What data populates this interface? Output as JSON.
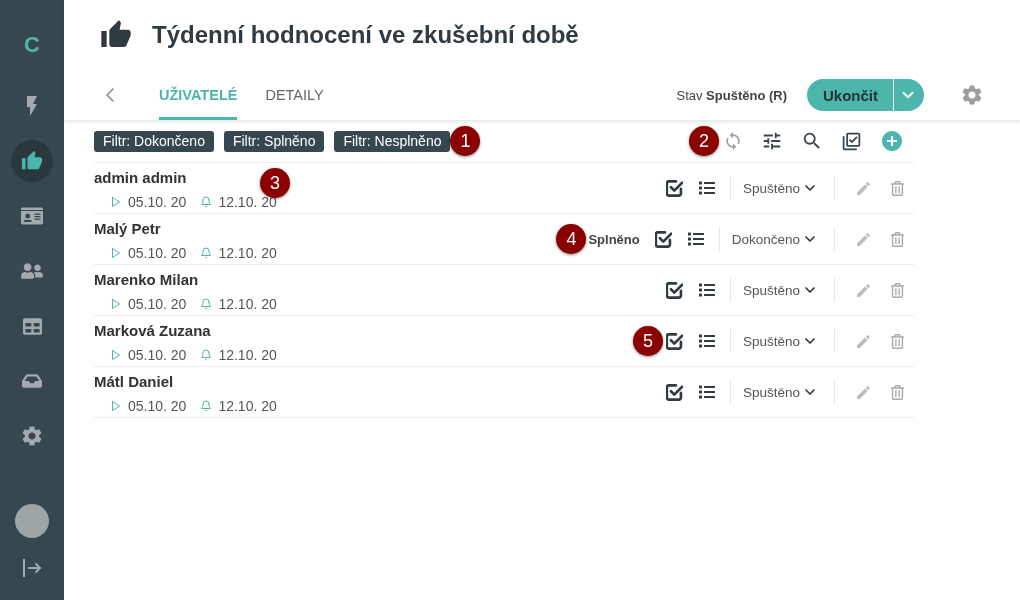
{
  "sidebar": {
    "logo": "C",
    "items": [
      {
        "selected": false
      },
      {
        "selected": true
      },
      {
        "selected": false
      },
      {
        "selected": false
      },
      {
        "selected": false
      },
      {
        "selected": false
      },
      {
        "selected": false
      }
    ]
  },
  "header": {
    "title": "Týdenní hodnocení ve zkušební době"
  },
  "tabs": [
    {
      "label": "UŽIVATELÉ",
      "selected": true
    },
    {
      "label": "DETAILY",
      "selected": false
    }
  ],
  "status_text": "Stav **Spuštěno (R)**",
  "action_button": {
    "label": "Ukončit"
  },
  "filters": {
    "chips": [
      "Filtr: Dokončeno",
      "Filtr: Splněno",
      "Filtr: Nesplněno"
    ],
    "callout": "1"
  },
  "toolbar": {
    "callout": "2"
  },
  "rows": [
    {
      "name": "admin admin",
      "start": "05.10. 20",
      "due": "12.10. 20",
      "status": "Spuštěno",
      "name_callout": "3"
    },
    {
      "name": "Malý Petr",
      "start": "05.10. 20",
      "due": "12.10. 20",
      "result": "Splněno",
      "result_callout": "4",
      "status": "Dokončeno"
    },
    {
      "name": "Marenko Milan",
      "start": "05.10. 20",
      "due": "12.10. 20",
      "status": "Spuštěno"
    },
    {
      "name": "Marková Zuzana",
      "start": "05.10. 20",
      "due": "12.10. 20",
      "actions_callout": "5",
      "status": "Spuštěno"
    },
    {
      "name": "Mátl Daniel",
      "start": "05.10. 20",
      "due": "12.10. 20",
      "status": "Spuštěno"
    }
  ]
}
